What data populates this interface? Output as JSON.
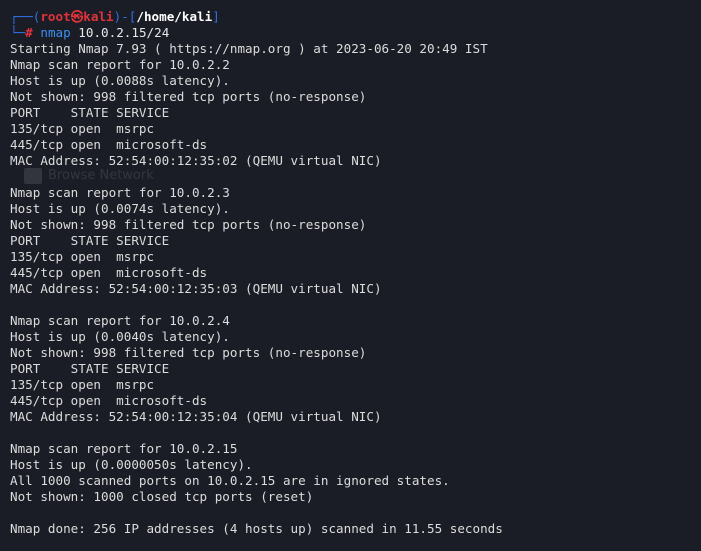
{
  "prompt": {
    "frame_top_left": "┌──(",
    "user": "root",
    "at_symbol": "㉿",
    "host": "kali",
    "frame_mid": ")-[",
    "cwd": "/home/kali",
    "frame_close": "]",
    "frame_bottom": "└─",
    "symbol": "#",
    "command": "nmap",
    "arguments": "10.0.2.15/24"
  },
  "background_ghost": {
    "label": "Browse Network"
  },
  "output": [
    "Starting Nmap 7.93 ( https://nmap.org ) at 2023-06-20 20:49 IST",
    "Nmap scan report for 10.0.2.2",
    "Host is up (0.0088s latency).",
    "Not shown: 998 filtered tcp ports (no-response)",
    "PORT    STATE SERVICE",
    "135/tcp open  msrpc",
    "445/tcp open  microsoft-ds",
    "MAC Address: 52:54:00:12:35:02 (QEMU virtual NIC)",
    "",
    "Nmap scan report for 10.0.2.3",
    "Host is up (0.0074s latency).",
    "Not shown: 998 filtered tcp ports (no-response)",
    "PORT    STATE SERVICE",
    "135/tcp open  msrpc",
    "445/tcp open  microsoft-ds",
    "MAC Address: 52:54:00:12:35:03 (QEMU virtual NIC)",
    "",
    "Nmap scan report for 10.0.2.4",
    "Host is up (0.0040s latency).",
    "Not shown: 998 filtered tcp ports (no-response)",
    "PORT    STATE SERVICE",
    "135/tcp open  msrpc",
    "445/tcp open  microsoft-ds",
    "MAC Address: 52:54:00:12:35:04 (QEMU virtual NIC)",
    "",
    "Nmap scan report for 10.0.2.15",
    "Host is up (0.0000050s latency).",
    "All 1000 scanned ports on 10.0.2.15 are in ignored states.",
    "Not shown: 1000 closed tcp ports (reset)",
    "",
    "Nmap done: 256 IP addresses (4 hosts up) scanned in 11.55 seconds"
  ],
  "colors": {
    "background": "#1b1d26",
    "frame": "#2f6fe4",
    "root": "#e0333c",
    "command": "#3d8ef0",
    "text": "#dcdcdc"
  }
}
